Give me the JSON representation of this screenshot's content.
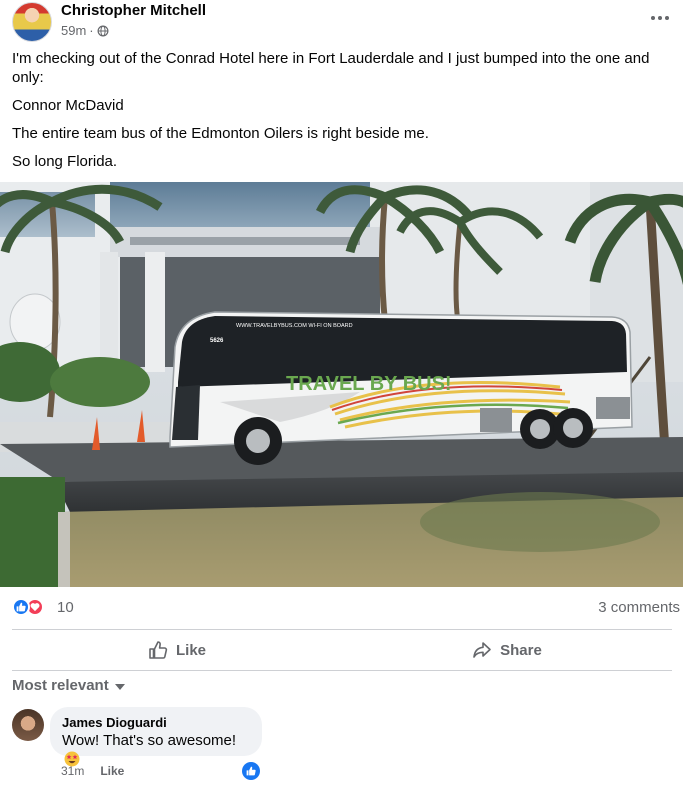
{
  "post": {
    "author": "Christopher Mitchell",
    "time": "59m",
    "audience_icon": "globe-icon",
    "paragraphs": [
      "I'm checking out of the Conrad Hotel here in Fort Lauderdale and I just bumped into the one and only:",
      "Connor McDavid",
      "The entire team bus of the Edmonton Oilers is right beside me.",
      "So long Florida."
    ],
    "photo": {
      "bus_wifi_text": "WWW.TRAVELBYBUS.COM WI-FI ON BOARD",
      "bus_number": "5626",
      "bus_brand": "TRAVEL BY BUS!"
    }
  },
  "reactions": {
    "icons": [
      "like-icon",
      "love-icon"
    ],
    "count": "10",
    "comments_label": "3 comments"
  },
  "actions": {
    "like_label": "Like",
    "share_label": "Share"
  },
  "comments": {
    "sort_label": "Most relevant",
    "items": [
      {
        "author": "James Dioguardi",
        "text": "Wow! That's so awesome!",
        "emoji": "star-struck-emoji",
        "time": "31m",
        "like_label": "Like",
        "reaction": "like-icon"
      }
    ]
  },
  "colors": {
    "primary_blue": "#1877f2",
    "love_red": "#f33e58",
    "secondary_text": "#65676b",
    "bubble_bg": "#f0f2f5"
  }
}
